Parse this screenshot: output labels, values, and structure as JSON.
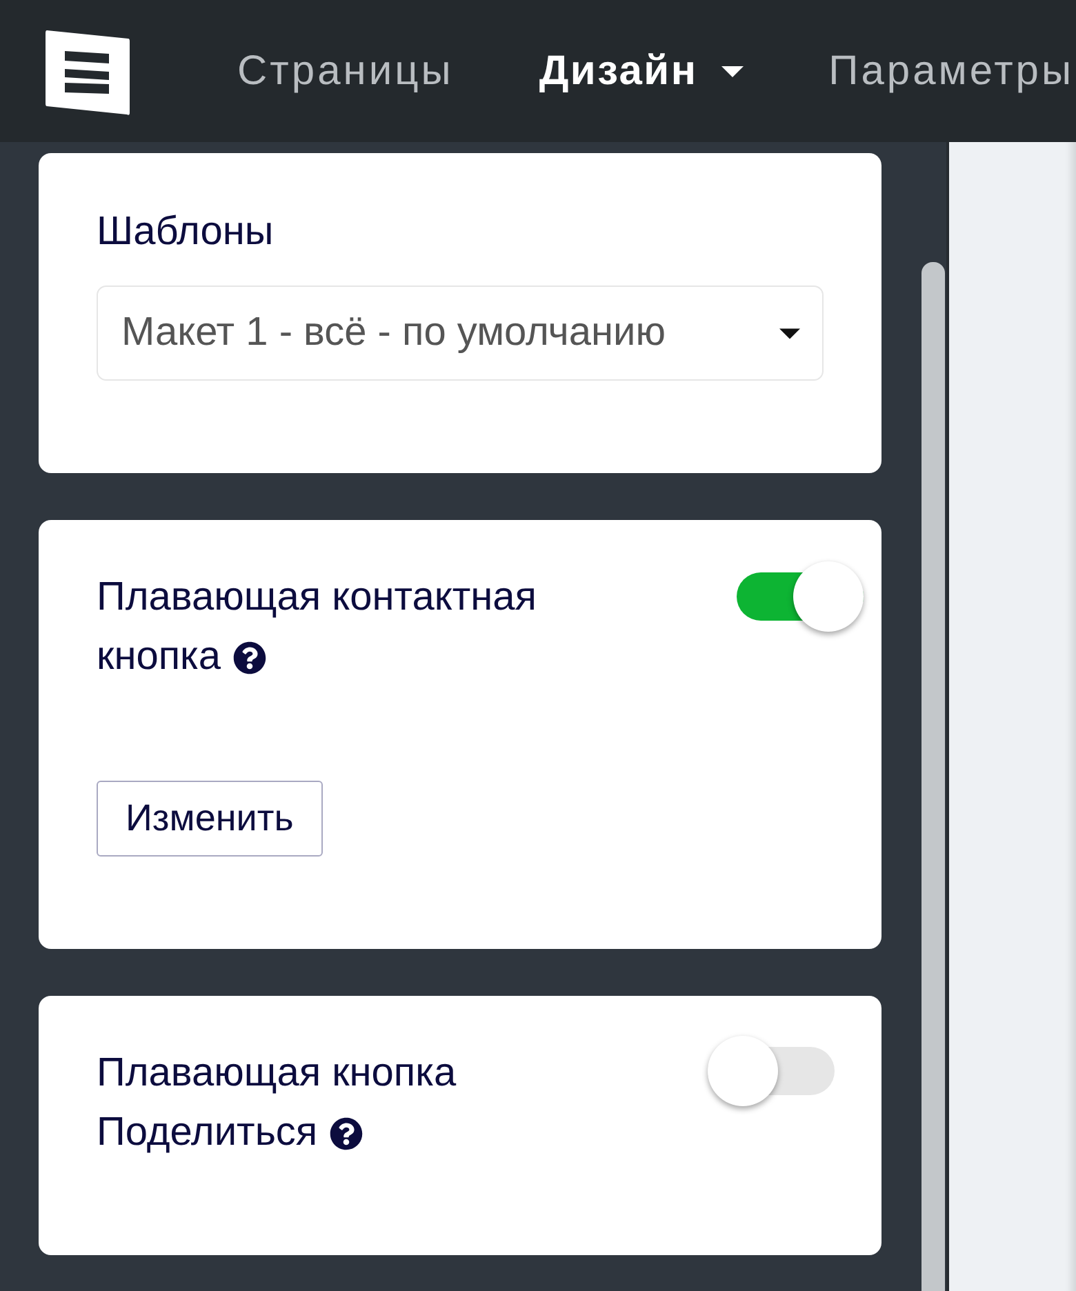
{
  "nav": {
    "items": [
      {
        "label": "Страницы",
        "selected": false,
        "has_menu": false
      },
      {
        "label": "Дизайн",
        "selected": true,
        "has_menu": true
      },
      {
        "label": "Параметры",
        "selected": false,
        "has_menu": false
      }
    ]
  },
  "sections": [
    {
      "kind": "select",
      "title": "Шаблоны",
      "value": "Макет 1 - всё - по умолчанию"
    },
    {
      "kind": "toggle",
      "title_lines": [
        "Плавающая контактная",
        "кнопка"
      ],
      "help": true,
      "on": true,
      "button": "Изменить"
    },
    {
      "kind": "toggle",
      "title_lines": [
        "Плавающая кнопка",
        "Поделиться"
      ],
      "help": true,
      "on": false
    }
  ]
}
